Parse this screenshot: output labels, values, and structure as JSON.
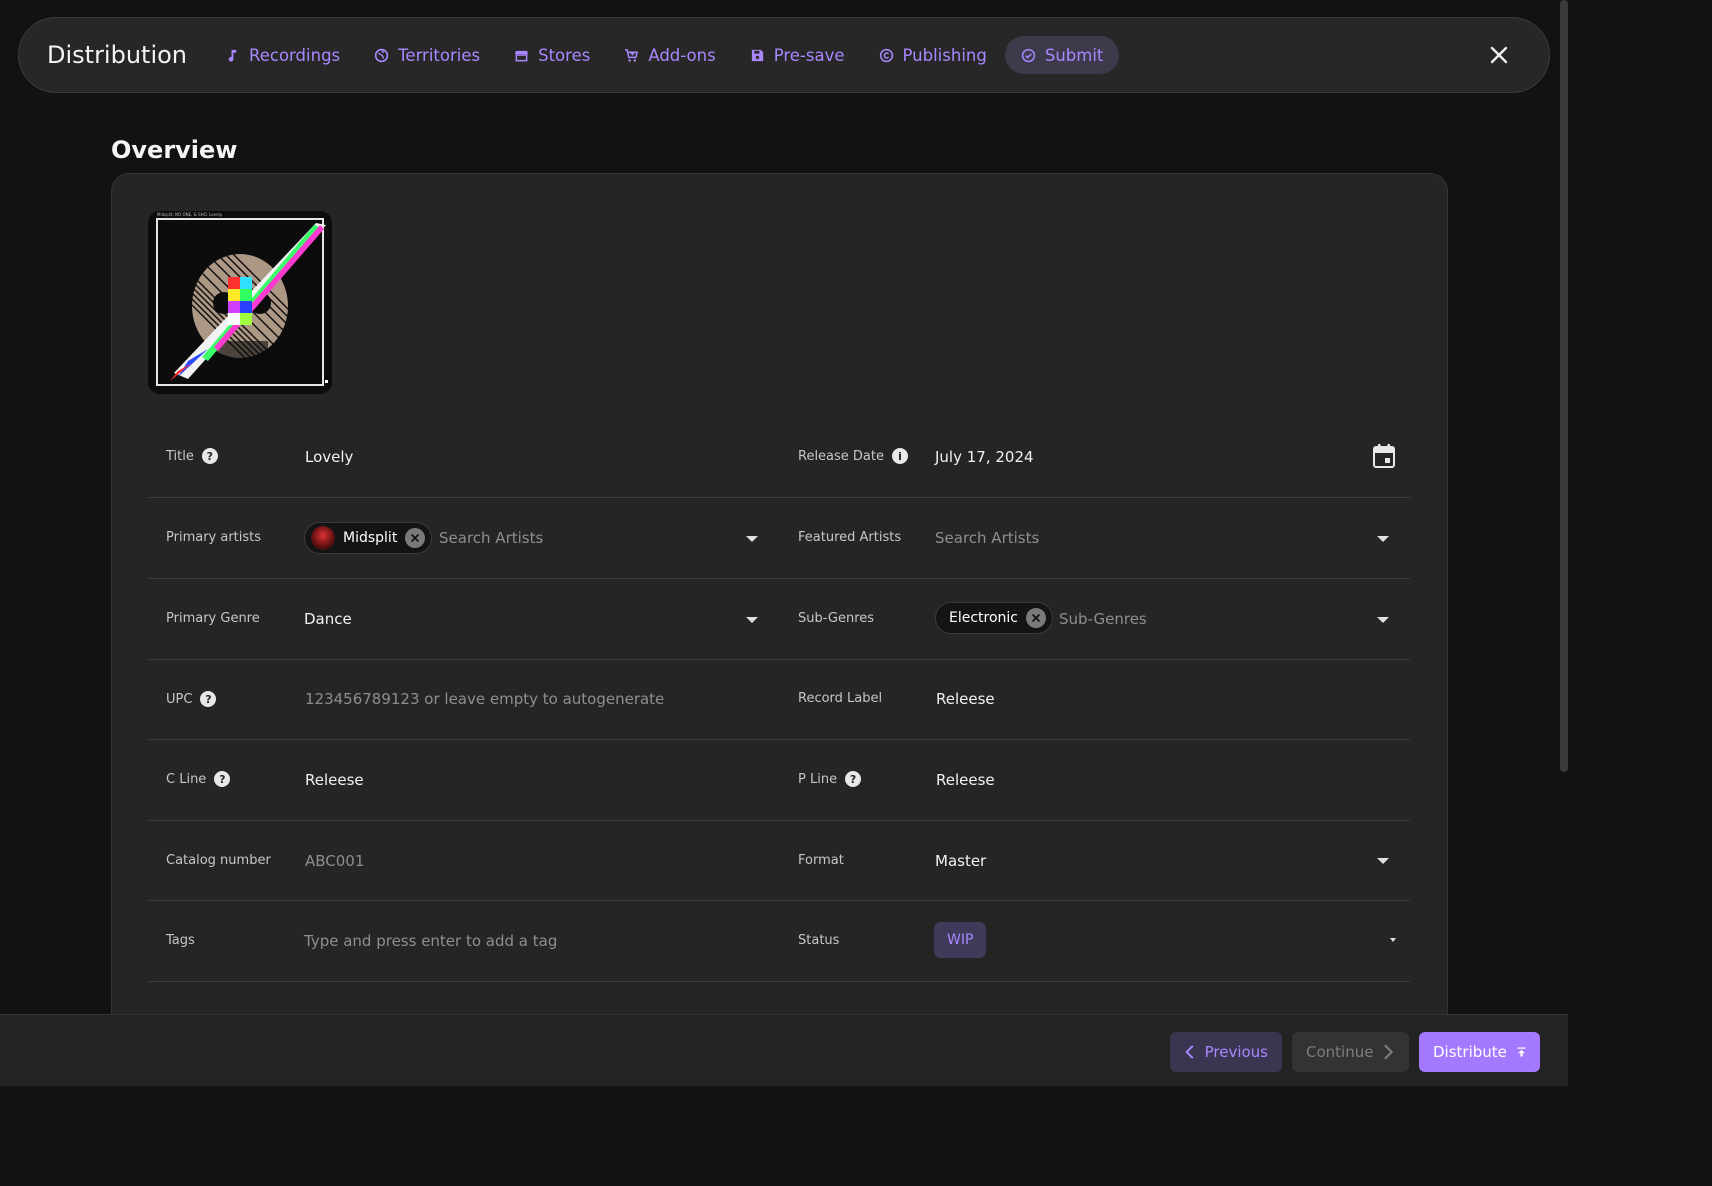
{
  "header": {
    "title": "Distribution",
    "tabs": [
      {
        "label": "Recordings",
        "icon": "music-note-icon"
      },
      {
        "label": "Territories",
        "icon": "globe-icon"
      },
      {
        "label": "Stores",
        "icon": "store-icon"
      },
      {
        "label": "Add-ons",
        "icon": "cart-icon"
      },
      {
        "label": "Pre-save",
        "icon": "save-icon"
      },
      {
        "label": "Publishing",
        "icon": "copyright-icon"
      },
      {
        "label": "Submit",
        "icon": "check-circle-icon",
        "active": true
      }
    ]
  },
  "overview": {
    "title": "Overview",
    "cover_caption": "Midsplit, NO ONE, & SHO. Lovely.",
    "fields": {
      "title": {
        "label": "Title",
        "value": "Lovely"
      },
      "release_date": {
        "label": "Release Date",
        "value": "July 17, 2024"
      },
      "primary_artists": {
        "label": "Primary artists",
        "chip": "Midsplit",
        "placeholder": "Search Artists"
      },
      "featured_artists": {
        "label": "Featured Artists",
        "placeholder": "Search Artists"
      },
      "primary_genre": {
        "label": "Primary Genre",
        "value": "Dance"
      },
      "sub_genres": {
        "label": "Sub-Genres",
        "chip": "Electronic",
        "placeholder": "Sub-Genres"
      },
      "upc": {
        "label": "UPC",
        "placeholder": "123456789123 or leave empty to autogenerate"
      },
      "record_label": {
        "label": "Record Label",
        "value": "Releese"
      },
      "c_line": {
        "label": "C Line",
        "value": "Releese"
      },
      "p_line": {
        "label": "P Line",
        "value": "Releese"
      },
      "catalog_number": {
        "label": "Catalog number",
        "placeholder": "ABC001"
      },
      "format": {
        "label": "Format",
        "value": "Master"
      },
      "tags": {
        "label": "Tags",
        "placeholder": "Type and press enter to add a tag"
      },
      "status": {
        "label": "Status",
        "value": "WIP"
      }
    }
  },
  "footer": {
    "previous": "Previous",
    "continue": "Continue",
    "distribute": "Distribute"
  },
  "colors": {
    "accent": "#a987ff",
    "background": "#121212",
    "card": "#252525"
  }
}
